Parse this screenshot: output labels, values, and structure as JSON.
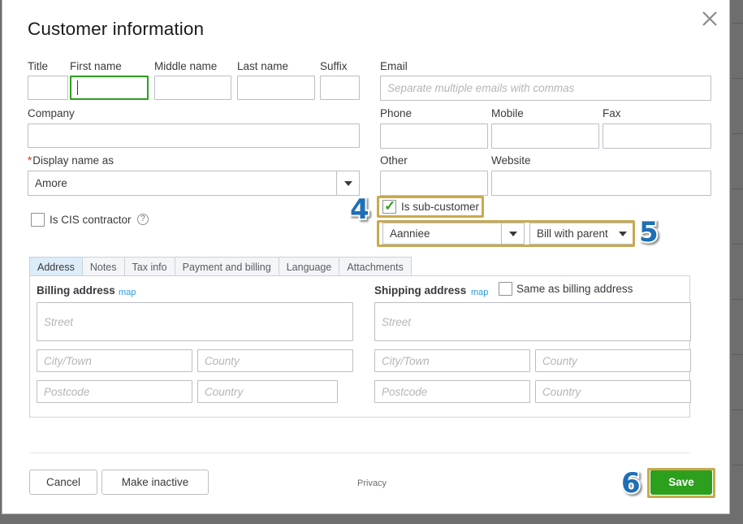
{
  "modal": {
    "title": "Customer information",
    "close_icon": "close-icon"
  },
  "name_row": {
    "title": {
      "label": "Title",
      "value": ""
    },
    "first_name": {
      "label": "First name",
      "value": ""
    },
    "middle_name": {
      "label": "Middle name",
      "value": ""
    },
    "last_name": {
      "label": "Last name",
      "value": ""
    },
    "suffix": {
      "label": "Suffix",
      "value": ""
    }
  },
  "company": {
    "label": "Company",
    "value": ""
  },
  "display_name": {
    "label": "Display name as",
    "required_marker": "*",
    "value": "Amore"
  },
  "cis_contractor": {
    "label": "Is CIS contractor",
    "checked": false,
    "help_icon": "question-mark-icon",
    "help_glyph": "?"
  },
  "contact": {
    "email": {
      "label": "Email",
      "placeholder": "Separate multiple emails with commas",
      "value": ""
    },
    "phone": {
      "label": "Phone",
      "value": ""
    },
    "mobile": {
      "label": "Mobile",
      "value": ""
    },
    "fax": {
      "label": "Fax",
      "value": ""
    },
    "other": {
      "label": "Other",
      "value": ""
    },
    "website": {
      "label": "Website",
      "value": ""
    }
  },
  "sub_customer": {
    "label": "Is sub-customer",
    "checked": true,
    "check_glyph": "✓",
    "parent": {
      "value": "Aanniee"
    },
    "billing_mode": {
      "value": "Bill with parent"
    }
  },
  "tabs": [
    {
      "label": "Address",
      "active": true
    },
    {
      "label": "Notes",
      "active": false
    },
    {
      "label": "Tax info",
      "active": false
    },
    {
      "label": "Payment and billing",
      "active": false
    },
    {
      "label": "Language",
      "active": false
    },
    {
      "label": "Attachments",
      "active": false
    }
  ],
  "billing_address": {
    "title": "Billing address",
    "map_link": "map",
    "street": {
      "placeholder": "Street",
      "value": ""
    },
    "city": {
      "placeholder": "City/Town",
      "value": ""
    },
    "county": {
      "placeholder": "County",
      "value": ""
    },
    "postcode": {
      "placeholder": "Postcode",
      "value": ""
    },
    "country": {
      "placeholder": "Country",
      "value": ""
    }
  },
  "shipping_address": {
    "title": "Shipping address",
    "map_link": "map",
    "same_as_billing": {
      "label": "Same as billing address",
      "checked": false
    },
    "street": {
      "placeholder": "Street",
      "value": ""
    },
    "city": {
      "placeholder": "City/Town",
      "value": ""
    },
    "county": {
      "placeholder": "County",
      "value": ""
    },
    "postcode": {
      "placeholder": "Postcode",
      "value": ""
    },
    "country": {
      "placeholder": "Country",
      "value": ""
    }
  },
  "footer": {
    "cancel": "Cancel",
    "make_inactive": "Make inactive",
    "privacy": "Privacy",
    "save": "Save"
  },
  "annotations": {
    "step4": "4",
    "step5": "5",
    "step6": "6"
  },
  "colors": {
    "accent_green": "#2ca01c",
    "highlight_gold": "#c9a94f",
    "badge_blue": "#1f6fb5",
    "link_blue": "#2c9ad8",
    "required_red": "#d52b1e",
    "active_tab": "#dcecf9"
  }
}
